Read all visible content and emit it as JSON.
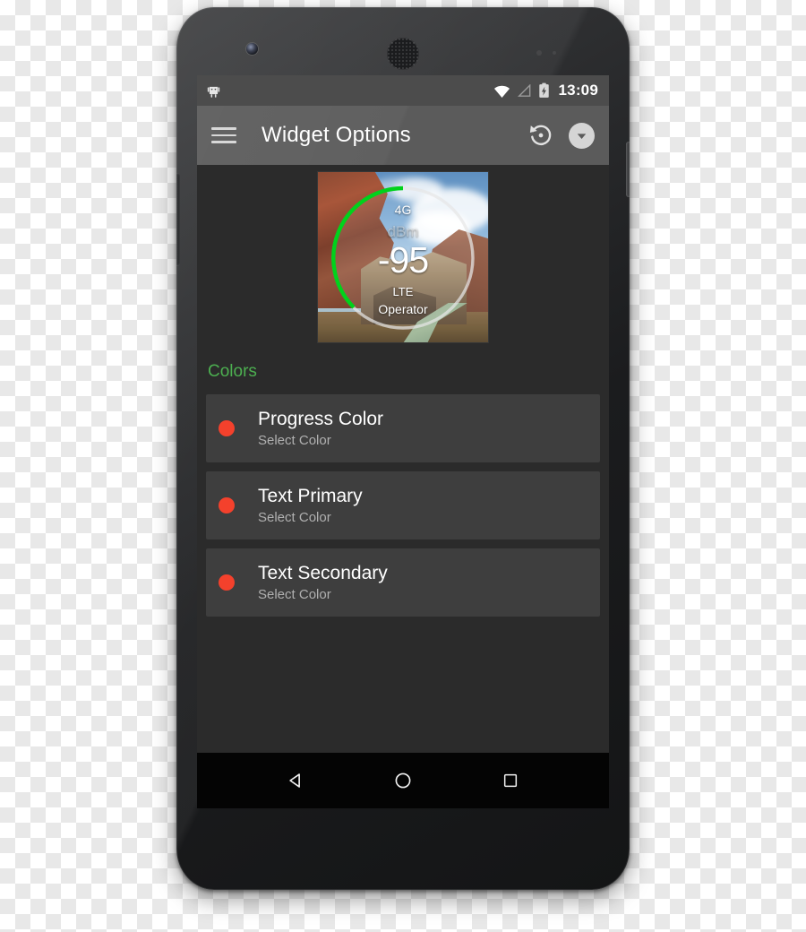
{
  "device": {
    "hardware": {
      "front_camera": "front-camera",
      "earpiece": "earpiece-speaker",
      "volume_rocker": "volume-rocker",
      "power_button": "power-button"
    }
  },
  "status_bar": {
    "notification_icon": "android-droid-icon",
    "wifi_icon": "wifi-icon",
    "signal_icon": "cellular-signal-icon",
    "battery_icon": "battery-charging-icon",
    "time": "13:09"
  },
  "toolbar": {
    "menu_icon": "hamburger-menu-icon",
    "title": "Widget Options",
    "restore_icon": "restore-history-icon",
    "overflow_icon": "chevron-down-icon"
  },
  "widget_preview": {
    "network": "4G",
    "unit": "dBm",
    "value": "-95",
    "technology": "LTE",
    "operator": "Operator",
    "progress_arc_color": "#00d21c",
    "track_color": "#e6e6e6"
  },
  "sections": [
    {
      "header": "Colors",
      "header_color": "#4caf50",
      "items": [
        {
          "title": "Progress Color",
          "subtitle": "Select Color",
          "swatch_color": "#f4412c"
        },
        {
          "title": "Text Primary",
          "subtitle": "Select Color",
          "swatch_color": "#f4412c"
        },
        {
          "title": "Text Secondary",
          "subtitle": "Select Color",
          "swatch_color": "#f4412c"
        }
      ]
    }
  ],
  "nav_bar": {
    "back": "back-triangle-icon",
    "home": "home-circle-icon",
    "recents": "recents-square-icon"
  },
  "colors": {
    "screen_background": "#2b2b2b",
    "card_background": "#3e3e3e",
    "toolbar_background": "#5b5b5b",
    "status_bar_background": "#4c4c4c",
    "nav_bar_background": "#040404",
    "primary_text": "#ffffff",
    "secondary_text": "#b0b0b0"
  }
}
